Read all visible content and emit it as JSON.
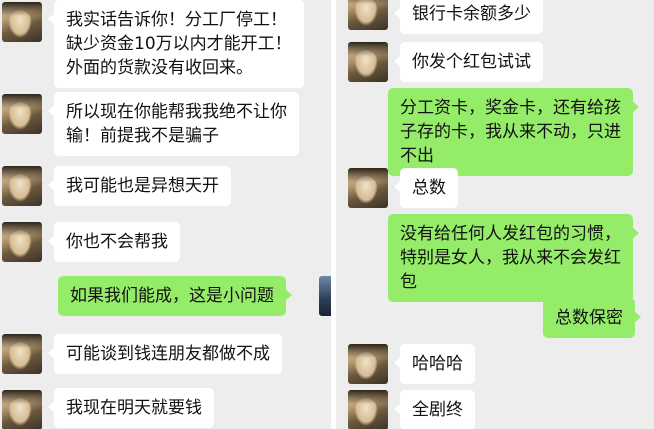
{
  "left_chat": {
    "messages": [
      {
        "lines": [
          "我实话告诉你！分工厂停工！",
          "缺少资金10万以内才能开工！",
          "外面的货款没有收回来。"
        ]
      },
      {
        "lines": [
          "所以现在你能帮我我绝不让你",
          "输！前提我不是骗子"
        ]
      },
      {
        "lines": [
          "我可能也是异想天开"
        ]
      },
      {
        "lines": [
          "你也不会帮我"
        ]
      },
      {
        "lines": [
          "如果我们能成，这是小问题"
        ]
      },
      {
        "lines": [
          "可能谈到钱连朋友都做不成"
        ]
      },
      {
        "lines": [
          "我现在明天就要钱"
        ]
      }
    ]
  },
  "right_chat": {
    "messages": [
      {
        "lines": [
          "银行卡余额多少"
        ]
      },
      {
        "lines": [
          "你发个红包试试"
        ]
      },
      {
        "lines": [
          "分工资卡，奖金卡，还有给孩",
          "子存的卡，我从来不动，只进",
          "不出"
        ]
      },
      {
        "lines": [
          "总数"
        ]
      },
      {
        "lines": [
          "没有给任何人发红包的习惯，",
          "特别是女人，我从来不会发红",
          "包"
        ]
      },
      {
        "lines": [
          "总数保密"
        ]
      },
      {
        "lines": [
          "哈哈哈"
        ]
      },
      {
        "lines": [
          "全剧终"
        ]
      }
    ]
  },
  "colors": {
    "incoming_bubble": "#ffffff",
    "outgoing_bubble": "#95ec69",
    "chat_background": "#ededed"
  }
}
